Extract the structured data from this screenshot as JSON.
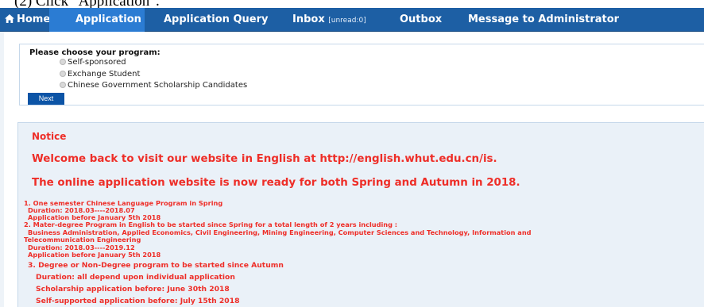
{
  "caption": "(2)  Click \"Application\".",
  "nav": {
    "home": "Home",
    "application": "Application",
    "query": "Application Query",
    "inbox": "Inbox",
    "inbox_unread": "[unread:0]",
    "outbox": "Outbox",
    "message": "Message to Administrator"
  },
  "program": {
    "title": "Please choose your program:",
    "options": [
      "Self-sponsored",
      "Exchange Student",
      "Chinese Government Scholarship Candidates"
    ],
    "next": "Next"
  },
  "notice": {
    "title": "Notice",
    "welcome": "Welcome back to visit our website in English at http://english.whut.edu.cn/is.",
    "ready": "The online application website is now ready for both Spring and Autumn in 2018.",
    "items": [
      "1. One semester Chinese Language Program in Spring",
      "Duration: 2018.03----2018.07",
      "Application before January 5th 2018",
      "2. Mater-degree Program in English to be started since Spring for a total length of 2 years including :",
      "Business Administration, Applied Economics, Civil Engineering, Mining Engineering, Computer Sciences and Technology, Information and",
      "Telecommunication Engineering",
      "Duration: 2018.03----2019.12",
      "Application before  January 5th 2018",
      "3. Degree or Non-Degree program to be started since Autumn",
      "Duration: all depend upon individual application",
      "Scholarship application before:  June 30th 2018",
      "Self-supported application before: July 15th 2018"
    ]
  }
}
